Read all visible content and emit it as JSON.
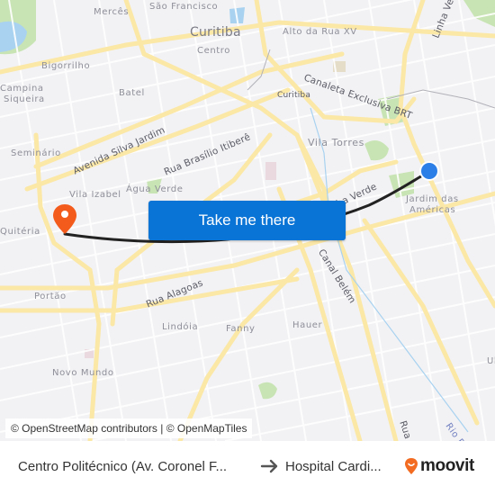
{
  "map": {
    "labels": {
      "merces": "Mercês",
      "sao_francisco": "São Francisco",
      "curitiba_city": "Curitiba",
      "centro": "Centro",
      "alto_da_rua_xv": "Alto da Rua XV",
      "linha_verde_top": "Linha Ve",
      "bigorrilho": "Bigorrilho",
      "campina_1": "Campina",
      "campina_2": "Siqueira",
      "batel": "Batel",
      "canaleta": "Canaleta Exclusiva BRT",
      "curitiba_station": "Curitiba",
      "seminario": "Seminário",
      "av_silva_jardim": "Avenida Silva Jardim",
      "rua_brasilio": "Rua Brasílio Itiberê",
      "vila_torres": "Vila Torres",
      "linha_verde": "Linha Verde",
      "vila_izabel": "Vila Izabel",
      "agua_verde": "Água Verde",
      "jardim_americas_1": "Jardim das",
      "jardim_americas_2": "Américas",
      "quiteria": "Quitéria",
      "canal_belem": "Canal Belém",
      "portao": "Portão",
      "rua_alagoas": "Rua Alagoas",
      "lindoia": "Lindóia",
      "fanny": "Fanny",
      "hauer": "Hauer",
      "novo_mundo": "Novo Mundo",
      "rua_da": "Rua da",
      "rio_be": "Rio Be",
      "ul": "Ul"
    },
    "colors": {
      "background": "#f2f2f4",
      "major_road": "#fbe7a6",
      "minor_road": "#ffffff",
      "park": "#c9e4b4",
      "water": "#a8d2f0",
      "route": "#222222",
      "origin_dot": "#2d7fe8",
      "destination_pin": "#f35b1c"
    },
    "origin_marker": "origin-dot-icon",
    "destination_marker": "destination-pin-icon"
  },
  "cta": {
    "label": "Take me there",
    "color": "#0a74d6"
  },
  "attribution": "© OpenStreetMap contributors | © OpenMapTiles",
  "footer": {
    "origin": "Centro Politécnico (Av. Coronel F...",
    "arrow_icon": "arrow-right-icon",
    "destination": "Hospital Cardi...",
    "brand": "moovit",
    "brand_color": "#f26b21"
  }
}
